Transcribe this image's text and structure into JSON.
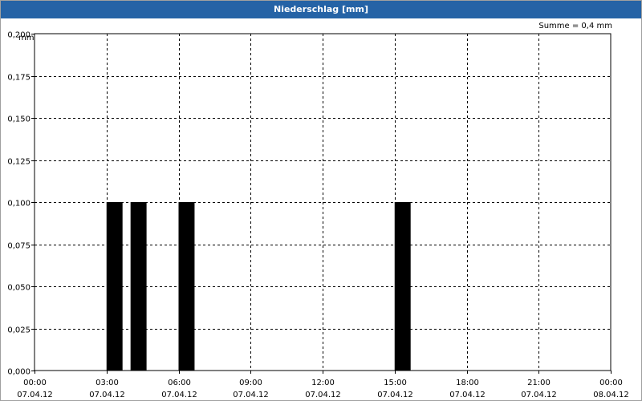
{
  "window": {
    "title": "Niederschlag [mm]"
  },
  "chart": {
    "unit_label": "mm",
    "sum_label": "Summe = 0,4 mm"
  },
  "colors": {
    "titlebar": "#2563a6",
    "bars": "#000000",
    "grid": "#000000"
  },
  "chart_data": {
    "type": "bar",
    "title": "Niederschlag [mm]",
    "ylabel": "mm",
    "ylim": [
      0,
      0.2
    ],
    "y_ticks": [
      "0,000",
      "0,025",
      "0,050",
      "0,075",
      "0,100",
      "0,125",
      "0,150",
      "0,175",
      "0,200"
    ],
    "x_ticks": [
      [
        "00:00",
        "07.04.12"
      ],
      [
        "03:00",
        "07.04.12"
      ],
      [
        "06:00",
        "07.04.12"
      ],
      [
        "09:00",
        "07.04.12"
      ],
      [
        "12:00",
        "07.04.12"
      ],
      [
        "15:00",
        "07.04.12"
      ],
      [
        "18:00",
        "07.04.12"
      ],
      [
        "21:00",
        "07.04.12"
      ],
      [
        "00:00",
        "08.04.12"
      ]
    ],
    "x_range": [
      "07.04.12 00:00",
      "08.04.12 00:00"
    ],
    "bars": [
      {
        "start": "07.04.12 03:00",
        "end": "07.04.12 03:40",
        "value": 0.1
      },
      {
        "start": "07.04.12 04:00",
        "end": "07.04.12 04:40",
        "value": 0.1
      },
      {
        "start": "07.04.12 06:00",
        "end": "07.04.12 06:40",
        "value": 0.1
      },
      {
        "start": "07.04.12 15:00",
        "end": "07.04.12 15:40",
        "value": 0.1
      }
    ],
    "grid": true,
    "total": "Summe = 0,4 mm"
  }
}
